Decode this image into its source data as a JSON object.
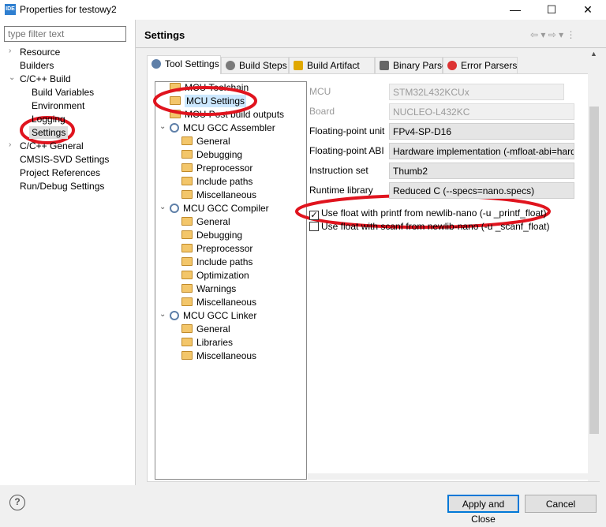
{
  "window": {
    "title": "Properties for testowy2",
    "icon_text": "IDE",
    "minimize": "—",
    "maximize": "☐",
    "close": "✕"
  },
  "sidebar": {
    "filter_placeholder": "type filter text",
    "items": [
      {
        "label": "Resource",
        "chev": "›"
      },
      {
        "label": "Builders"
      },
      {
        "label": "C/C++ Build",
        "chev": "⌄"
      },
      {
        "label": "Build Variables"
      },
      {
        "label": "Environment"
      },
      {
        "label": "Logging"
      },
      {
        "label": "Settings",
        "selected": true
      },
      {
        "label": "C/C++ General",
        "chev": "›"
      },
      {
        "label": "CMSIS-SVD Settings"
      },
      {
        "label": "Project References"
      },
      {
        "label": "Run/Debug Settings"
      }
    ]
  },
  "header": {
    "title": "Settings",
    "nav": "⇦ ▾ ⇨ ▾ ⋮"
  },
  "tabs": [
    {
      "label": "Tool Settings",
      "icon": "gear-icon"
    },
    {
      "label": "Build Steps",
      "icon": "hammer-icon"
    },
    {
      "label": "Build Artifact",
      "icon": "trophy-icon"
    },
    {
      "label": "Binary Parsers",
      "icon": "binary-icon"
    },
    {
      "label": "Error Parsers",
      "icon": "error-icon"
    }
  ],
  "tree": [
    {
      "label": "MCU Toolchain",
      "level": 0
    },
    {
      "label": "MCU Settings",
      "level": 0,
      "selected": true
    },
    {
      "label": "MCU Post build outputs",
      "level": 0
    },
    {
      "label": "MCU GCC Assembler",
      "level": 0,
      "group": true
    },
    {
      "label": "General",
      "level": 1
    },
    {
      "label": "Debugging",
      "level": 1
    },
    {
      "label": "Preprocessor",
      "level": 1
    },
    {
      "label": "Include paths",
      "level": 1
    },
    {
      "label": "Miscellaneous",
      "level": 1
    },
    {
      "label": "MCU GCC Compiler",
      "level": 0,
      "group": true
    },
    {
      "label": "General",
      "level": 1
    },
    {
      "label": "Debugging",
      "level": 1
    },
    {
      "label": "Preprocessor",
      "level": 1
    },
    {
      "label": "Include paths",
      "level": 1
    },
    {
      "label": "Optimization",
      "level": 1
    },
    {
      "label": "Warnings",
      "level": 1
    },
    {
      "label": "Miscellaneous",
      "level": 1
    },
    {
      "label": "MCU GCC Linker",
      "level": 0,
      "group": true
    },
    {
      "label": "General",
      "level": 1
    },
    {
      "label": "Libraries",
      "level": 1
    },
    {
      "label": "Miscellaneous",
      "level": 1
    }
  ],
  "form": {
    "fields": [
      {
        "label": "MCU",
        "value": "STM32L432KCUx",
        "disabled": true
      },
      {
        "label": "Board",
        "value": "NUCLEO-L432KC",
        "disabled": true
      },
      {
        "label": "Floating-point unit",
        "value": "FPv4-SP-D16"
      },
      {
        "label": "Floating-point ABI",
        "value": "Hardware implementation (-mfloat-abi=hard)"
      },
      {
        "label": "Instruction set",
        "value": "Thumb2"
      },
      {
        "label": "Runtime library",
        "value": "Reduced C (--specs=nano.specs)"
      }
    ],
    "checkboxes": [
      {
        "label": "Use float with printf from newlib-nano (-u _printf_float)",
        "checked": true
      },
      {
        "label": "Use float with scanf from newlib-nano (-u _scanf_float)",
        "checked": false
      }
    ]
  },
  "footer": {
    "help": "?",
    "apply_close": "Apply and Close",
    "cancel": "Cancel"
  },
  "annotation_color": "#e0141e"
}
